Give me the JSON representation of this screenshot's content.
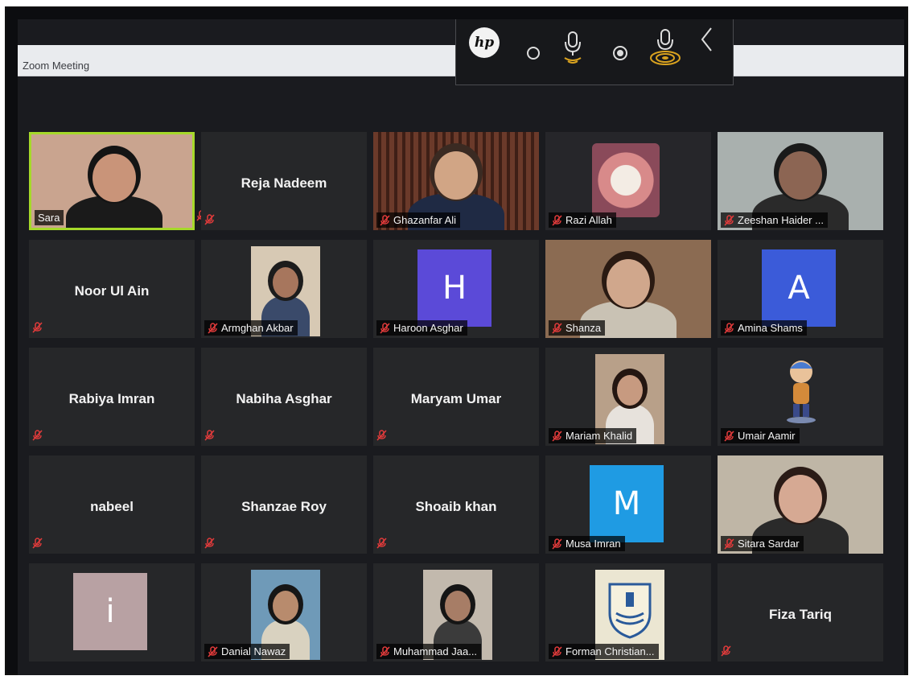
{
  "window": {
    "title": "Zoom Meeting"
  },
  "hp_toolbar": {
    "logo": "hp",
    "icons": [
      "circle-icon",
      "mic-wave-icon",
      "record-icon",
      "mic-broadcast-icon",
      "chevron-left-icon"
    ]
  },
  "colors": {
    "active_speaker_border": "#a6d92a",
    "mute_icon": "#e23b3b",
    "avatar_purple": "#5b4ad8",
    "avatar_blue": "#3b5bd9",
    "avatar_cyan": "#1f9be3",
    "avatar_mauve": "#b8a1a3"
  },
  "participants": [
    {
      "name": "Sara",
      "video": true,
      "active_speaker": true,
      "muted": true
    },
    {
      "name": "Reja Nadeem",
      "video": false,
      "muted": true
    },
    {
      "name": "Ghazanfar Ali",
      "video": true,
      "muted": true
    },
    {
      "name": "Razi Allah",
      "video": true,
      "muted": true
    },
    {
      "name": "Zeeshan Haider ...",
      "video": true,
      "muted": true
    },
    {
      "name": "Noor Ul Ain",
      "video": false,
      "muted": true
    },
    {
      "name": "Armghan Akbar",
      "video": true,
      "muted": true
    },
    {
      "name": "Haroon Asghar",
      "avatar_letter": "H",
      "muted": true
    },
    {
      "name": "Shanza",
      "video": true,
      "muted": true
    },
    {
      "name": "Amina Shams",
      "avatar_letter": "A",
      "muted": true
    },
    {
      "name": "Rabiya Imran",
      "video": false,
      "muted": true
    },
    {
      "name": "Nabiha Asghar",
      "video": false,
      "muted": true
    },
    {
      "name": "Maryam Umar",
      "video": false,
      "muted": true
    },
    {
      "name": "Mariam Khalid",
      "video": true,
      "muted": true
    },
    {
      "name": "Umair Aamir",
      "video": true,
      "muted": true
    },
    {
      "name": "nabeel",
      "video": false,
      "muted": true
    },
    {
      "name": "Shanzae Roy",
      "video": false,
      "muted": true
    },
    {
      "name": "Shoaib khan",
      "video": false,
      "muted": true
    },
    {
      "name": "Musa Imran",
      "avatar_letter": "M",
      "muted": true
    },
    {
      "name": "Sitara Sardar",
      "video": true,
      "muted": true
    },
    {
      "name": "",
      "avatar_letter": "i",
      "muted": true
    },
    {
      "name": "Danial Nawaz",
      "video": true,
      "muted": true
    },
    {
      "name": "Muhammad Jaa...",
      "video": true,
      "muted": true
    },
    {
      "name": "Forman Christian...",
      "video": true,
      "muted": true
    },
    {
      "name": "Fiza Tariq",
      "video": false,
      "muted": true
    }
  ]
}
